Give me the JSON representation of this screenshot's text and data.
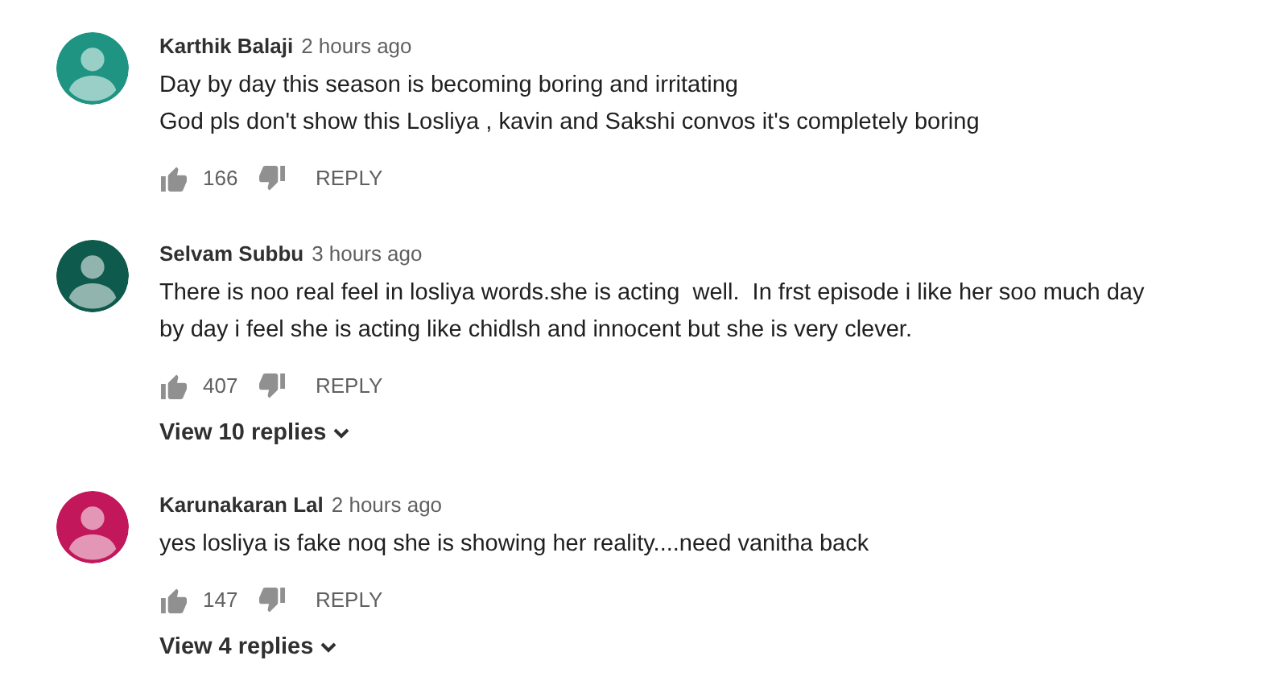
{
  "comments": [
    {
      "author": "Karthik Balaji",
      "time": "2 hours ago",
      "color": "#1f9483",
      "text": "Day by day this season is becoming boring and irritating\nGod pls don't show this Losliya , kavin and Sakshi convos it's completely boring",
      "likes": "166",
      "reply": "REPLY"
    },
    {
      "author": "Selvam Subbu",
      "time": "3 hours ago",
      "color": "#0e5a4c",
      "text": "There is noo real feel in losliya words.she is acting  well.  In frst episode i like her soo much day\nby day i feel she is acting like chidlsh and innocent but she is very clever.",
      "likes": "407",
      "reply": "REPLY",
      "view_replies": "View 10 replies"
    },
    {
      "author": "Karunakaran Lal",
      "time": "2 hours ago",
      "color": "#c2185b",
      "text": "yes losliya is fake noq she is showing her reality....need vanitha back",
      "likes": "147",
      "reply": "REPLY",
      "view_replies": "View 4 replies"
    }
  ]
}
